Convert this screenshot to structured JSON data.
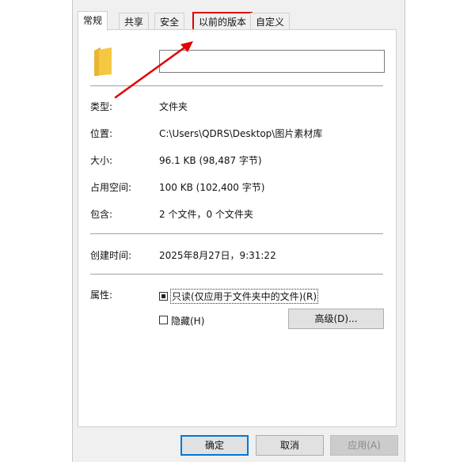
{
  "tabs": [
    {
      "label": "常规"
    },
    {
      "label": "共享"
    },
    {
      "label": "安全"
    },
    {
      "label": "以前的版本"
    },
    {
      "label": "自定义"
    }
  ],
  "name_input": {
    "value": ""
  },
  "props": {
    "type_label": "类型:",
    "type_value": "文件夹",
    "location_label": "位置:",
    "location_value": "C:\\Users\\QDRS\\Desktop\\图片素材库",
    "size_label": "大小:",
    "size_value": "96.1 KB (98,487 字节)",
    "disk_label": "占用空间:",
    "disk_value": "100 KB (102,400 字节)",
    "contains_label": "包含:",
    "contains_value": "2 个文件，0 个文件夹",
    "created_label": "创建时间:",
    "created_value": "2025年8月27日，9:31:22",
    "attr_label": "属性:"
  },
  "attributes": {
    "readonly_label": "只读(仅应用于文件夹中的文件)(R)",
    "hidden_label": "隐藏(H)",
    "advanced_label": "高级(D)..."
  },
  "buttons": {
    "ok": "确定",
    "cancel": "取消",
    "apply": "应用(A)"
  },
  "colors": {
    "highlight_red": "#e00000",
    "folder_yellow": "#f5c842",
    "default_blue": "#0078d7"
  }
}
